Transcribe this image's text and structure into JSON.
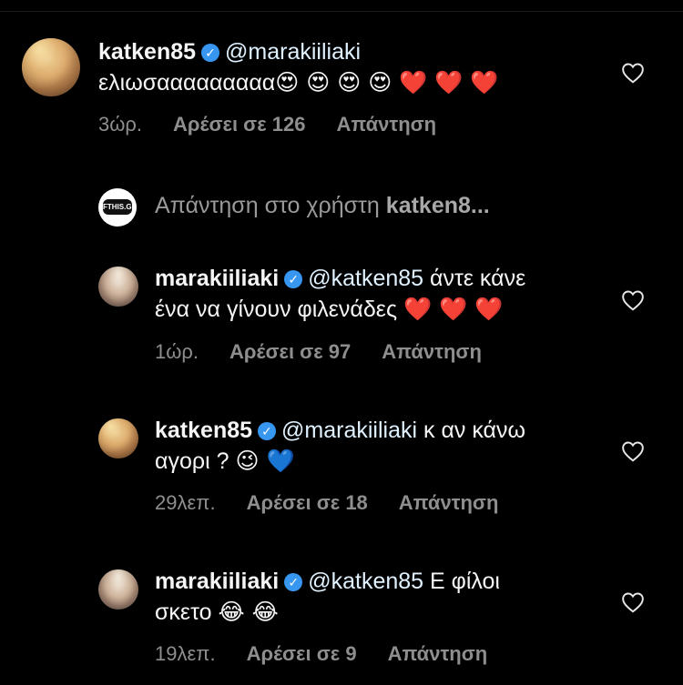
{
  "comments": [
    {
      "username": "katken85",
      "mention": "@marakiiliaki",
      "line1": "",
      "line2_text": "ελιωσααααααααα",
      "line2_emojis": "😍 😍 😍 😍 ❤️ ❤️ ❤️",
      "time": "3ώρ.",
      "likes": "Αρέσει σε 126",
      "reply": "Απάντηση"
    },
    {
      "username": "marakiiliaki",
      "mention": "@katken85",
      "line1": "άντε κάνε",
      "line2_text": "ένα να γίνουν φιλενάδες",
      "line2_emojis": "❤️ ❤️ ❤️",
      "time": "1ώρ.",
      "likes": "Αρέσει σε 97",
      "reply": "Απάντηση"
    },
    {
      "username": "katken85",
      "mention": "@marakiiliaki",
      "line1": "κ αν κάνω",
      "line2_text": "αγορι ?",
      "line2_emojis": "😉 💙",
      "time": "29λεπ.",
      "likes": "Αρέσει σε 18",
      "reply": "Απάντηση"
    },
    {
      "username": "marakiiliaki",
      "mention": "@katken85",
      "line1": "Ε φίλοι",
      "line2_text": "σκετο",
      "line2_emojis": "😂 😂",
      "time": "19λεπ.",
      "likes": "Αρέσει σε 9",
      "reply": "Απάντηση"
    }
  ],
  "reply_bar": {
    "prefix": "Απάντηση στο χρήστη",
    "target": "katken8...",
    "logo_text": "FTHIS.GR"
  },
  "icons": {
    "verified": "verified-badge-icon",
    "like": "heart-outline-icon"
  },
  "colors": {
    "background": "#000000",
    "text": "#f5f5f5",
    "muted": "#8e8e8e",
    "verified": "#3797f0"
  }
}
